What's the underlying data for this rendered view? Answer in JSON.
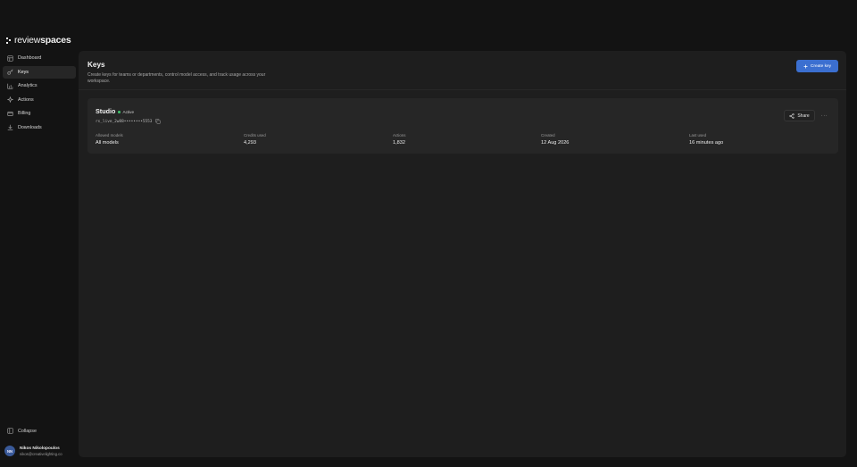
{
  "brand": {
    "name_light": "review",
    "name_bold": "spaces"
  },
  "sidebar": {
    "items": [
      {
        "label": "Dashboard",
        "icon": "dashboard-icon"
      },
      {
        "label": "Keys",
        "icon": "key-icon",
        "active": true
      },
      {
        "label": "Analytics",
        "icon": "analytics-icon"
      },
      {
        "label": "Actions",
        "icon": "actions-icon"
      },
      {
        "label": "Billing",
        "icon": "billing-icon"
      },
      {
        "label": "Downloads",
        "icon": "download-icon"
      }
    ],
    "collapse_label": "Collapse"
  },
  "user": {
    "initials": "NN",
    "name": "Nikos Nikolopoulos",
    "email": "nikos@creativelighting.co"
  },
  "header": {
    "title": "Keys",
    "description": "Create keys for teams or departments, control model access, and track usage across your workspace.",
    "create_label": "Create key"
  },
  "key_card": {
    "name": "Studio",
    "status": "Active",
    "token": "rs_live_2w88••••••••5553",
    "share_label": "Share",
    "more_label": "···",
    "stats": [
      {
        "label": "Allowed models",
        "value": "All models"
      },
      {
        "label": "Credits used",
        "value": "4,293"
      },
      {
        "label": "Actions",
        "value": "1,832"
      },
      {
        "label": "Created",
        "value": "12 Aug 2026"
      },
      {
        "label": "Last used",
        "value": "16 minutes ago"
      }
    ]
  },
  "colors": {
    "background": "#131313",
    "panel": "#1e1e1e",
    "card": "#262626",
    "accent": "#3b6fd0",
    "status_active": "#3fbf6a"
  }
}
